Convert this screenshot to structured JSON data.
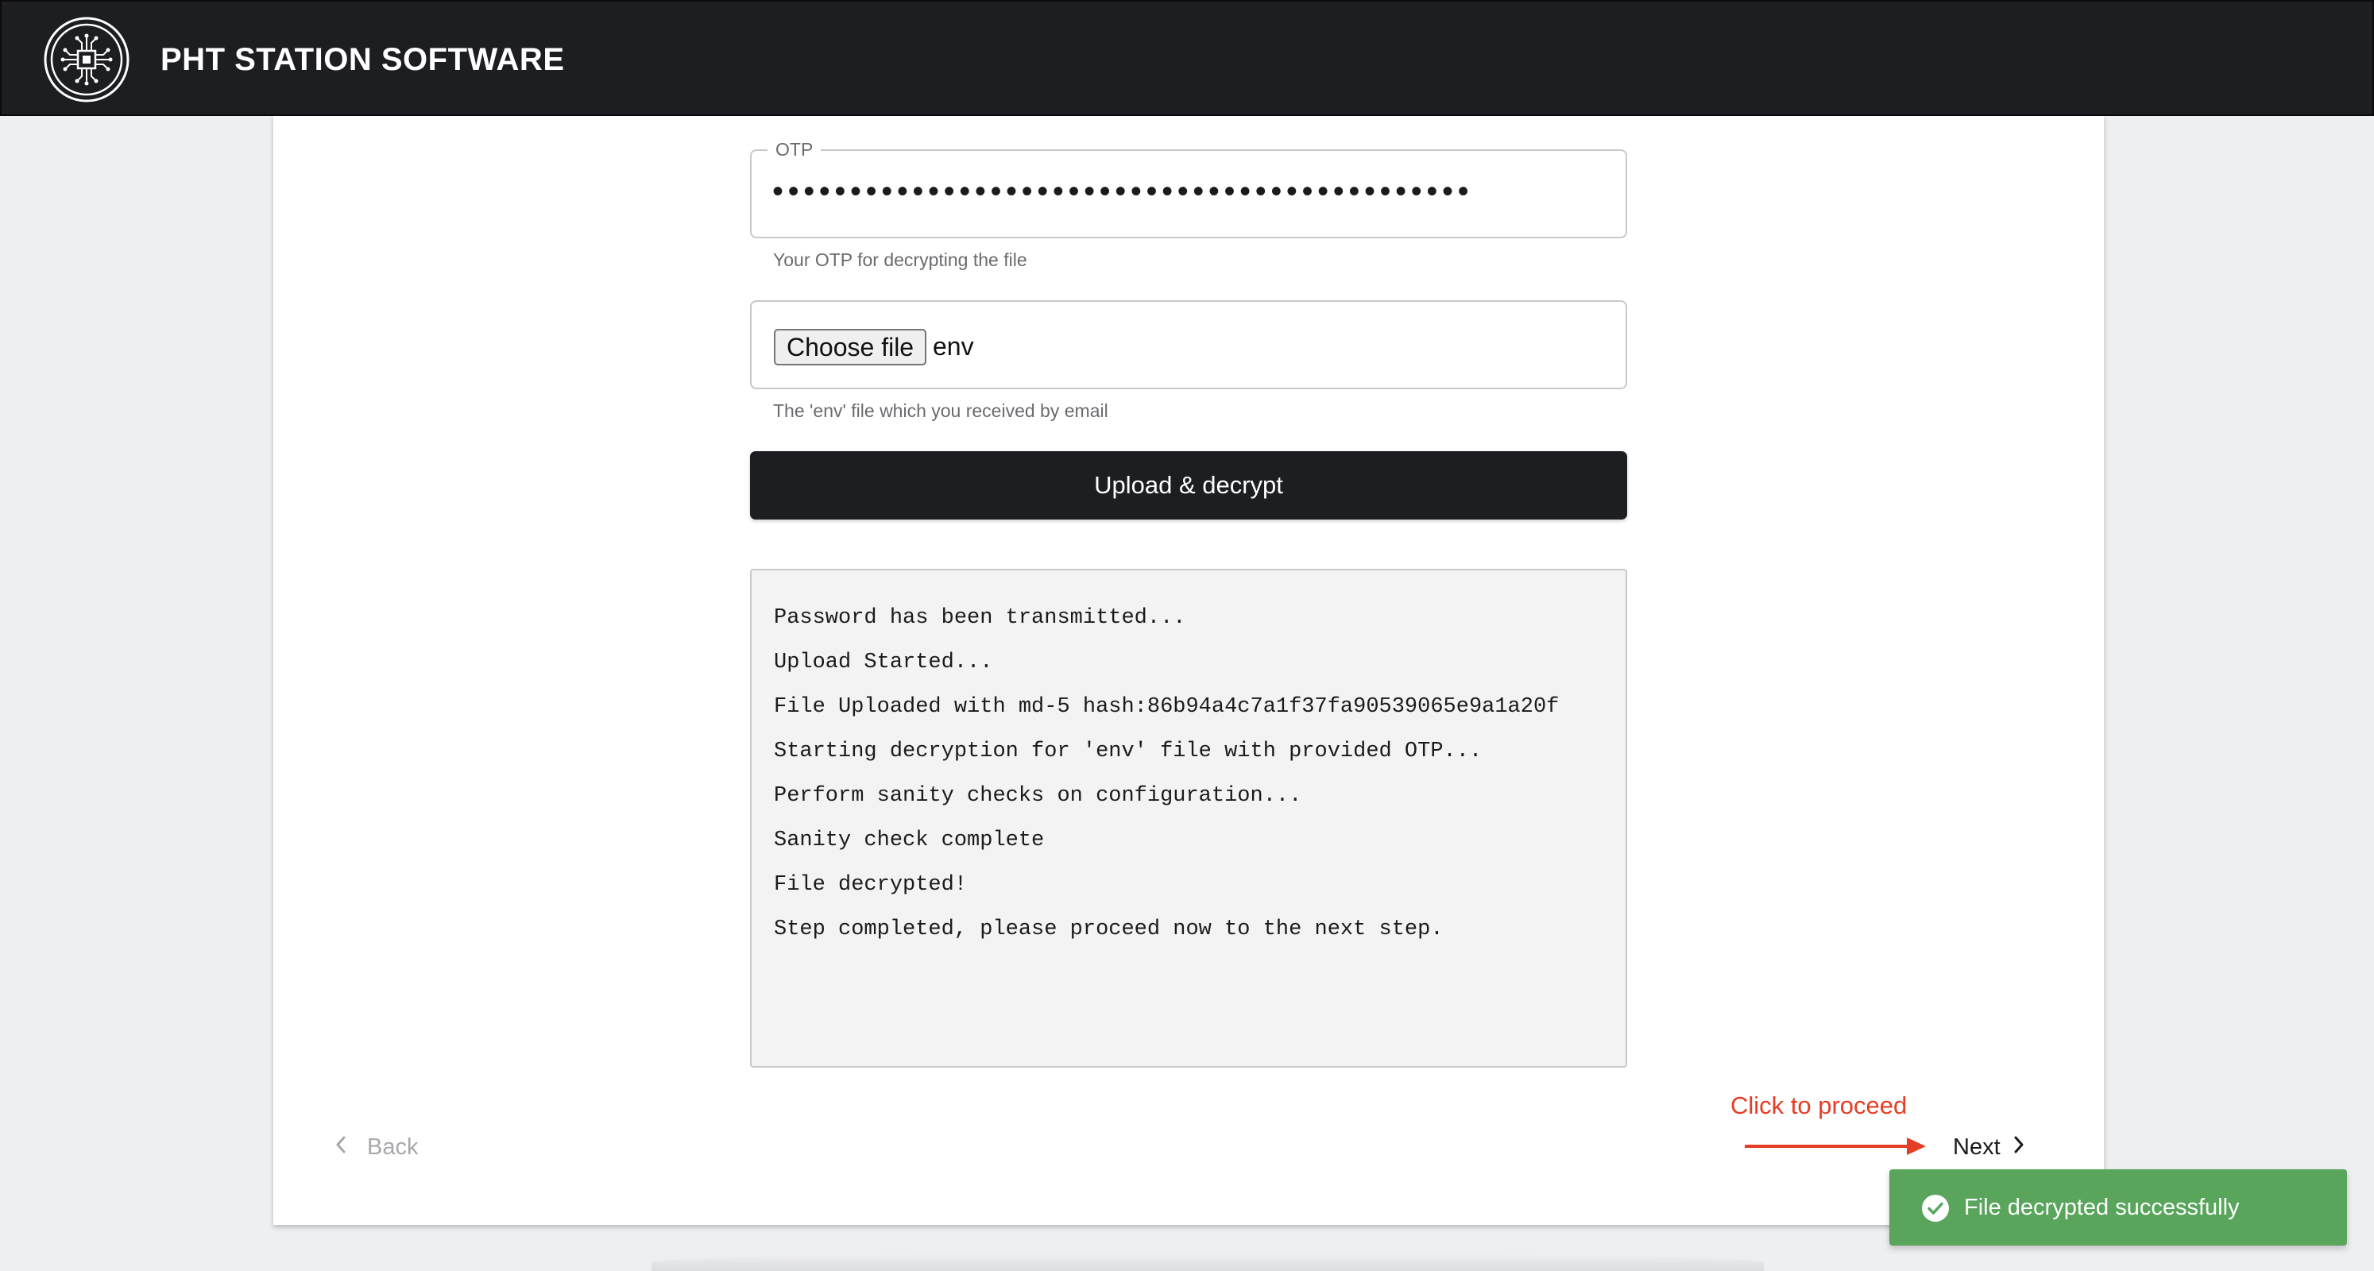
{
  "header": {
    "app_title": "PHT STATION SOFTWARE",
    "logo_icon": "circuit-chip-logo-icon",
    "background": "#1d1e22"
  },
  "form": {
    "otp": {
      "label": "OTP",
      "value": "•••••••••••••••••••••••••••••••••••••••••••••",
      "helper": "Your OTP for decrypting the file"
    },
    "file": {
      "button_label": "Choose file",
      "file_name": "env",
      "helper": "The 'env' file which you received by email"
    },
    "upload_button_label": "Upload & decrypt"
  },
  "log": {
    "lines": [
      "Password has been transmitted...",
      "Upload Started...",
      "File Uploaded with md-5 hash:86b94a4c7a1f37fa90539065e9a1a20f",
      "Starting decryption for 'env' file with provided OTP...",
      "Perform sanity checks on configuration...",
      "Sanity check complete",
      "File decrypted!",
      "Step completed, please proceed now to the next step."
    ]
  },
  "navigation": {
    "back_label": "Back",
    "next_label": "Next"
  },
  "annotation": {
    "text": "Click to proceed",
    "color": "#e53d26"
  },
  "toast": {
    "message": "File decrypted successfully",
    "icon": "check-circle-icon",
    "color": "#58a55b"
  }
}
